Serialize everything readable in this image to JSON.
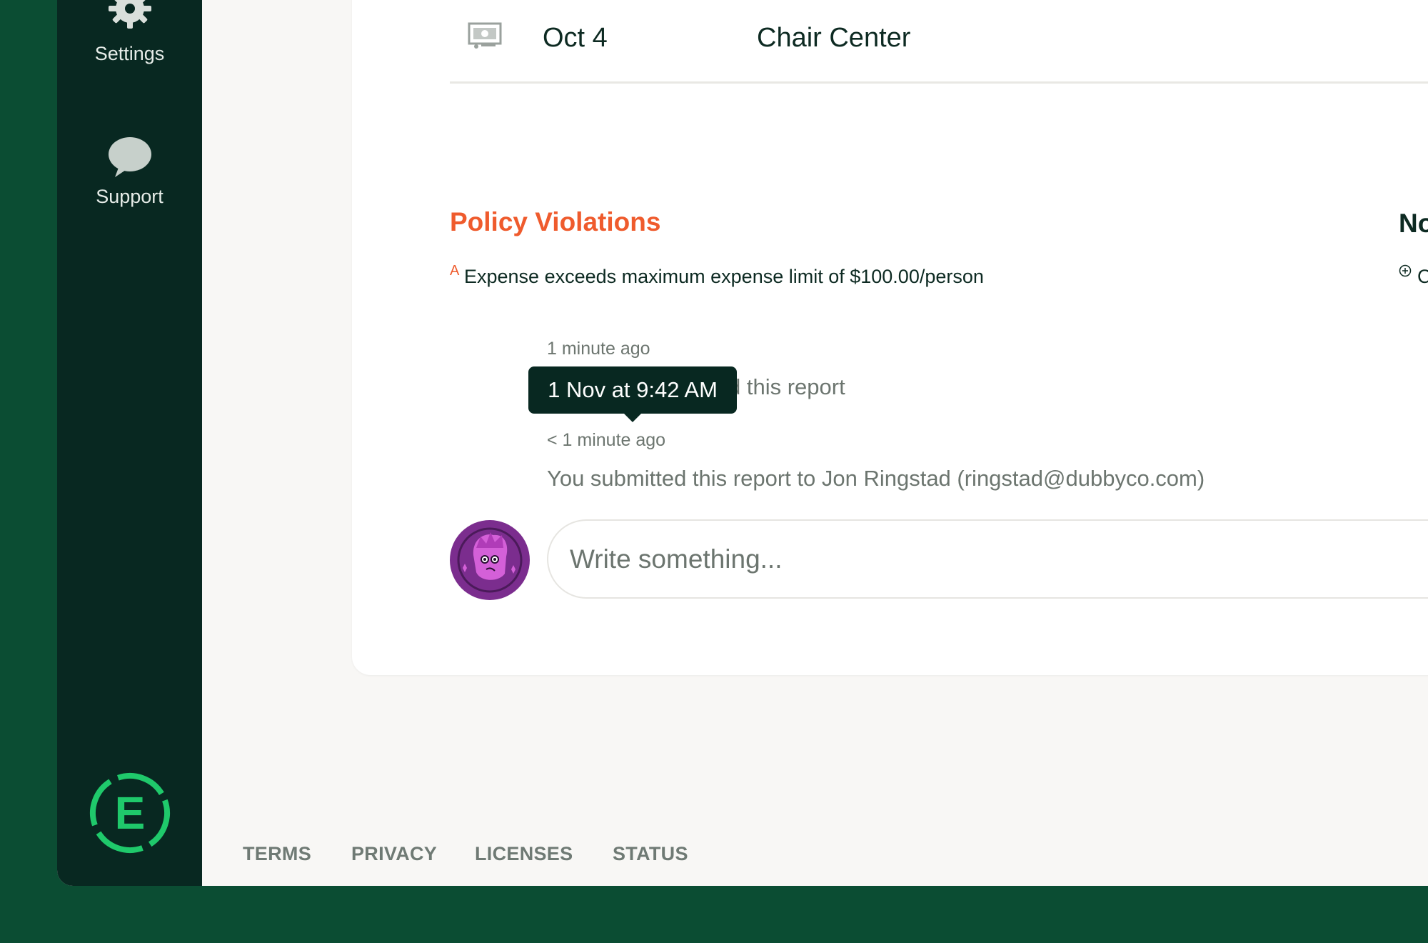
{
  "sidebar": {
    "items": [
      {
        "label": "Settings",
        "icon": "gear-icon"
      },
      {
        "label": "Support",
        "icon": "chat-bubble-icon"
      }
    ],
    "brand_letter": "E"
  },
  "expense_row": {
    "icon": "receipt-icon",
    "date": "Oct 4",
    "merchant": "Chair Center"
  },
  "policy_violations": {
    "title": "Policy Violations",
    "marker": "A",
    "text": "Expense exceeds maximum expense limit of $100.00/person"
  },
  "notes": {
    "title": "Notes",
    "icon": "plus-circle-icon",
    "text": "Cash ex"
  },
  "timeline": [
    {
      "time": "1 minute ago",
      "text": "d this report"
    },
    {
      "time": "< 1 minute ago",
      "text": "You submitted this report to Jon Ringstad (ringstad@dubbyco.com)"
    }
  ],
  "tooltip": {
    "text": "1 Nov at 9:42 AM"
  },
  "comment": {
    "placeholder": "Write something..."
  },
  "footer": {
    "links": [
      "TERMS",
      "PRIVACY",
      "LICENSES",
      "STATUS"
    ]
  },
  "colors": {
    "outer_bg": "#0b4d33",
    "sidebar_bg": "#082821",
    "accent_green": "#1fc96b",
    "violation_orange": "#ef5b2d",
    "avatar_purple": "#7b2d8e"
  }
}
